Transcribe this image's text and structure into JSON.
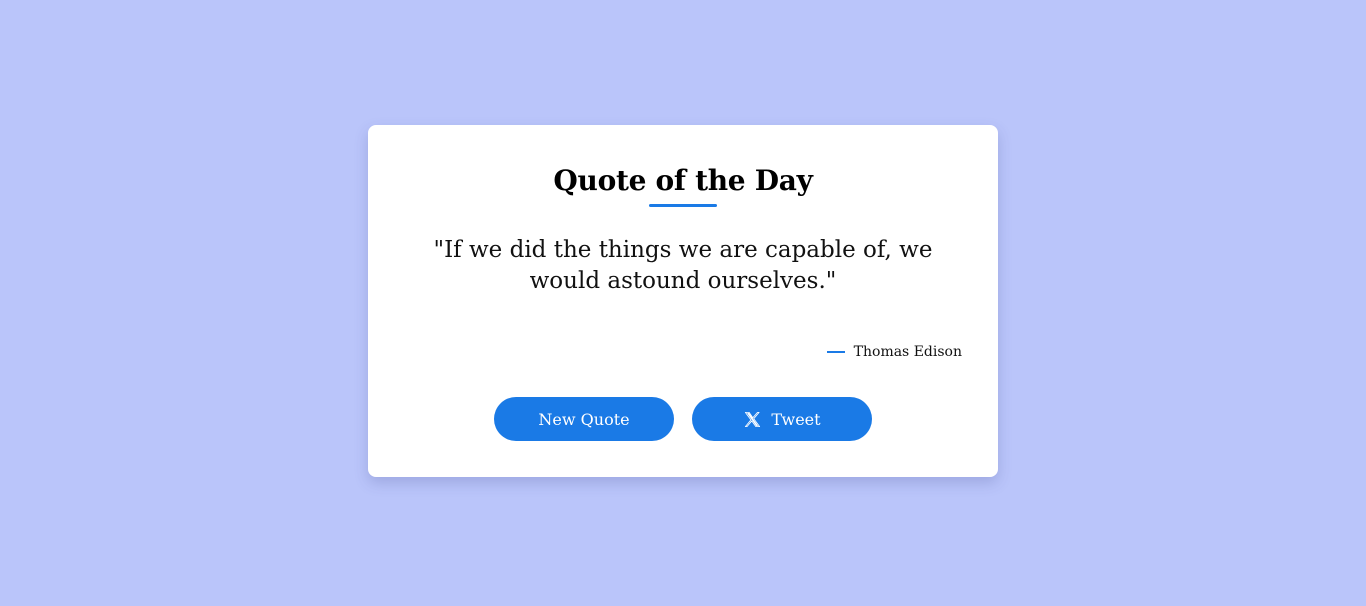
{
  "card": {
    "title": "Quote of the Day",
    "quote": "\"If we did the things we are capable of, we would astound ourselves.\"",
    "author": "Thomas Edison"
  },
  "actions": {
    "new_quote_label": "New Quote",
    "tweet_label": "Tweet",
    "tweet_icon": "x-logo-icon"
  },
  "colors": {
    "background": "#bac5fa",
    "accent": "#1a7ae6",
    "card": "#ffffff"
  }
}
